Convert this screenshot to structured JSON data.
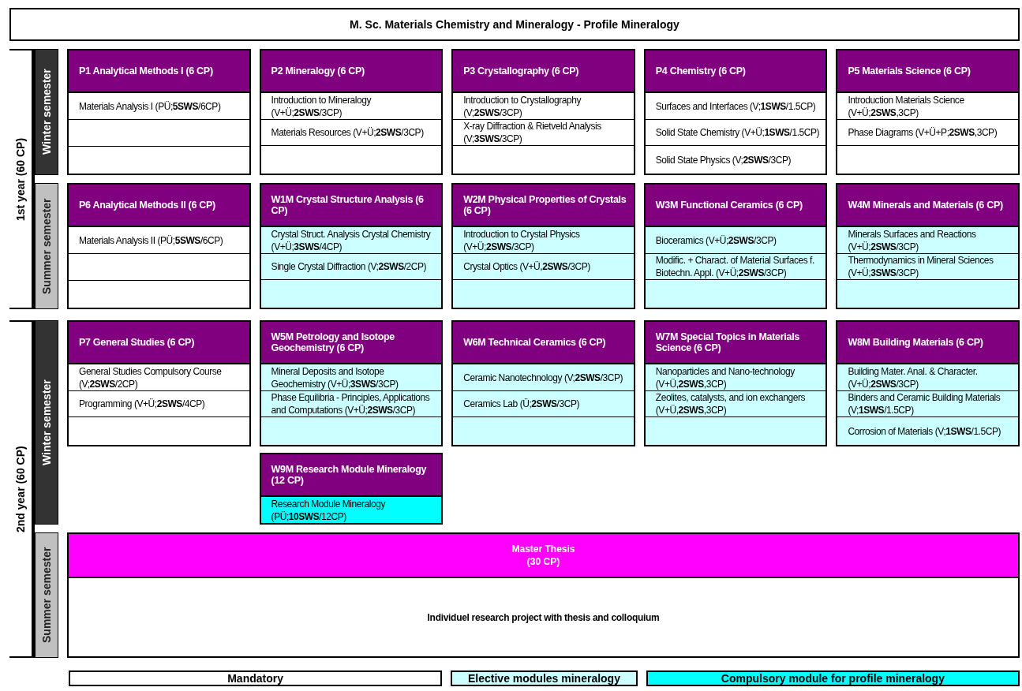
{
  "title": "M. Sc. Materials Chemistry and Mineralogy -  Profile Mineralogy",
  "years": [
    {
      "label": "1st year (60 CP)",
      "semesters": [
        {
          "label": "Winter semester",
          "kind": "winter",
          "modules": [
            {
              "title": "P1 Analytical Methods I (6 CP)",
              "kind": "mandatory",
              "courses": [
                "Materials Analysis I (PÜ;**5SWS**/6CP)"
              ]
            },
            {
              "title": "P2 Mineralogy (6 CP)",
              "kind": "mandatory",
              "courses": [
                "Introduction to Mineralogy (V+Ü;**2SWS**/3CP)",
                "Materials Resources (V+Ü;**2SWS**/3CP)"
              ]
            },
            {
              "title": "P3 Crystallography (6 CP)",
              "kind": "mandatory",
              "courses": [
                "Introduction to Crystallography (V;**2SWS**/3CP)",
                "X-ray Diffraction & Rietveld Analysis (V;**3SWS**/3CP)"
              ]
            },
            {
              "title": "P4 Chemistry (6 CP)",
              "kind": "mandatory",
              "courses": [
                "Surfaces and Interfaces (V;**1SWS**/1.5CP)",
                "Solid State Chemistry (V+Ü;**1SWS**/1.5CP)",
                "Solid State Physics (V;**2SWS**/3CP)"
              ]
            },
            {
              "title": "P5 Materials Science (6 CP)",
              "kind": "mandatory",
              "courses": [
                "Introduction Materials Science (V+Ü;**2SWS**,3CP)",
                "Phase Diagrams (V+Ü+P;**2SWS**,3CP)"
              ]
            }
          ]
        },
        {
          "label": "Summer semester",
          "kind": "summer",
          "modules": [
            {
              "title": "P6 Analytical Methods II (6 CP)",
              "kind": "mandatory",
              "courses": [
                "Materials Analysis II (PÜ;**5SWS**/6CP)"
              ]
            },
            {
              "title": "W1M Crystal Structure Analysis (6 CP)",
              "kind": "elective",
              "courses": [
                "Crystal Struct. Analysis Crystal Chemistry (V+Ü;**3SWS**/4CP)",
                "Single Crystal Diffraction (V;**2SWS**/2CP)"
              ]
            },
            {
              "title": "W2M Physical Properties of Crystals (6 CP)",
              "kind": "elective",
              "courses": [
                "Introduction to Crystal Physics (V+Ü;**2SWS**/3CP)",
                "Crystal Optics (V+Ü,**2SWS**/3CP)"
              ]
            },
            {
              "title": "W3M Functional Ceramics (6 CP)",
              "kind": "elective",
              "courses": [
                "Bioceramics (V+Ü;**2SWS**/3CP)",
                "Modific. + Charact. of Material Surfaces f. Biotechn. Appl. (V+Ü;**2SWS**/3CP)"
              ]
            },
            {
              "title": "W4M Minerals and Materials (6 CP)",
              "kind": "elective",
              "courses": [
                "Minerals Surfaces and Reactions (V+Ü;**2SWS**/3CP)",
                "Thermodynamics in Mineral Sciences (V+Ü;**3SWS**/3CP)"
              ]
            }
          ]
        }
      ]
    },
    {
      "label": "2nd year (60 CP)",
      "semesters": [
        {
          "label": "Winter semester",
          "kind": "winter",
          "modules": [
            {
              "title": "P7 General Studies (6 CP)",
              "kind": "mandatory",
              "courses": [
                "General Studies Compulsory Course (V;**2SWS**/2CP)",
                "Programming (V+Ü;**2SWS**/4CP)"
              ]
            },
            {
              "title": "W5M Petrology and Isotope Geochemistry (6 CP)",
              "kind": "elective",
              "courses": [
                "Mineral Deposits and Isotope Geochemistry (V+Ü;**3SWS**/3CP)",
                "Phase Equilibria - Principles, Applications and Computations (V+Ü;**2SWS**/3CP)"
              ]
            },
            {
              "title": "W6M Technical Ceramics (6 CP)",
              "kind": "elective",
              "courses": [
                "Ceramic Nanotechnology (V;**2SWS**/3CP)",
                "Ceramics Lab (Ü;**2SWS**/3CP)"
              ]
            },
            {
              "title": "W7M Special Topics in Materials Science (6 CP)",
              "kind": "elective",
              "courses": [
                "Nanoparticles and Nano-technology (V+Ü,**2SWS**,3CP)",
                "Zeolites, catalysts, and ion exchangers (V+Ü,**2SWS**,3CP)"
              ]
            },
            {
              "title": "W8M Building Materials (6 CP)",
              "kind": "elective",
              "courses": [
                "Building Mater. Anal. & Character. (V+Ü;**2SWS**/3CP)",
                "Binders and Ceramic Building Materials (V;**1SWS**/1.5CP)",
                "Corrosion of Materials (V;**1SWS**/1.5CP)"
              ]
            }
          ],
          "extra_modules": [
            {
              "title": "W9M Research Module Mineralogy (12 CP)",
              "kind": "profile",
              "courses": [
                "Research Module Mineralogy (PÜ;**10SWS**/12CP)"
              ]
            }
          ]
        },
        {
          "label": "Summer semester",
          "kind": "summer",
          "thesis": {
            "title": "Master Thesis",
            "credits": "(30 CP)",
            "description": "Individuel research project with thesis and colloquium"
          }
        }
      ]
    }
  ],
  "legend": [
    {
      "label": "Mandatory",
      "kind": "mandatory"
    },
    {
      "label": "Elective modules mineralogy",
      "kind": "elective"
    },
    {
      "label": "Compulsory module for profile mineralogy",
      "kind": "profile"
    }
  ]
}
